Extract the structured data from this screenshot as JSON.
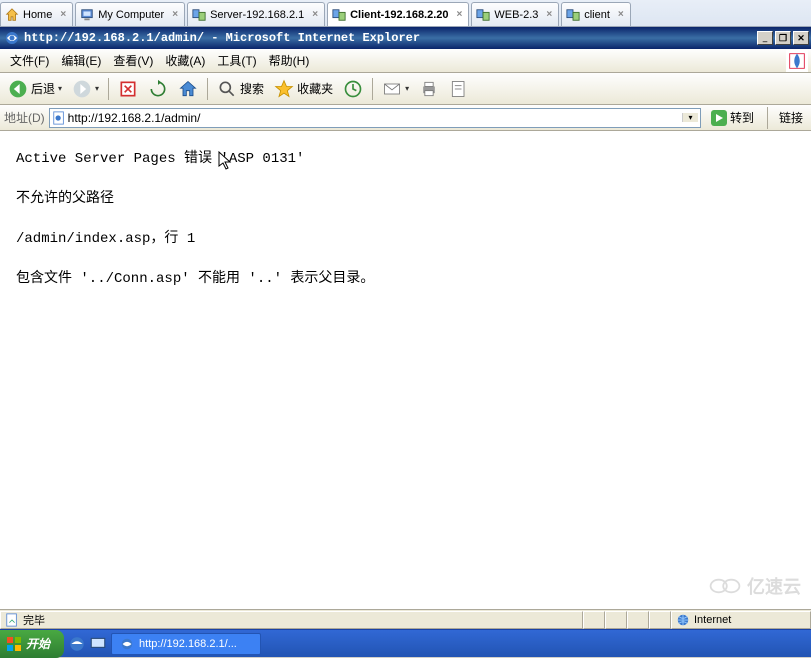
{
  "outer_tabs": [
    {
      "label": "Home",
      "icon": "home-icon",
      "close": true,
      "active": false
    },
    {
      "label": "My Computer",
      "icon": "computer-icon",
      "close": true,
      "active": false
    },
    {
      "label": "Server-192.168.2.1",
      "icon": "server-icon",
      "close": true,
      "active": false
    },
    {
      "label": "Client-192.168.2.20",
      "icon": "server-icon",
      "close": true,
      "active": true
    },
    {
      "label": "WEB-2.3",
      "icon": "server-icon",
      "close": true,
      "active": false
    },
    {
      "label": "client",
      "icon": "server-icon",
      "close": true,
      "active": false
    }
  ],
  "titlebar": {
    "text": "http://192.168.2.1/admin/ - Microsoft Internet Explorer"
  },
  "titlebar_controls": {
    "min": "_",
    "restore": "❐",
    "close": "✕"
  },
  "menus": [
    {
      "label": "文件(F)"
    },
    {
      "label": "编辑(E)"
    },
    {
      "label": "查看(V)"
    },
    {
      "label": "收藏(A)"
    },
    {
      "label": "工具(T)"
    },
    {
      "label": "帮助(H)"
    }
  ],
  "toolbar": {
    "back": "后退",
    "search": "搜索",
    "favorites": "收藏夹"
  },
  "address": {
    "label": "地址(D)",
    "url": "http://192.168.2.1/admin/",
    "go": "转到",
    "links": "链接"
  },
  "page": {
    "line1": "Active Server Pages 错误 'ASP 0131'",
    "line2": "不允许的父路径",
    "line3": "/admin/index.asp，行 1",
    "line4": "包含文件 '../Conn.asp' 不能用 '..' 表示父目录。"
  },
  "status": {
    "done": "完毕",
    "zone": "Internet"
  },
  "taskbar": {
    "start": "开始",
    "task": "http://192.168.2.1/..."
  },
  "watermark": "亿速云"
}
